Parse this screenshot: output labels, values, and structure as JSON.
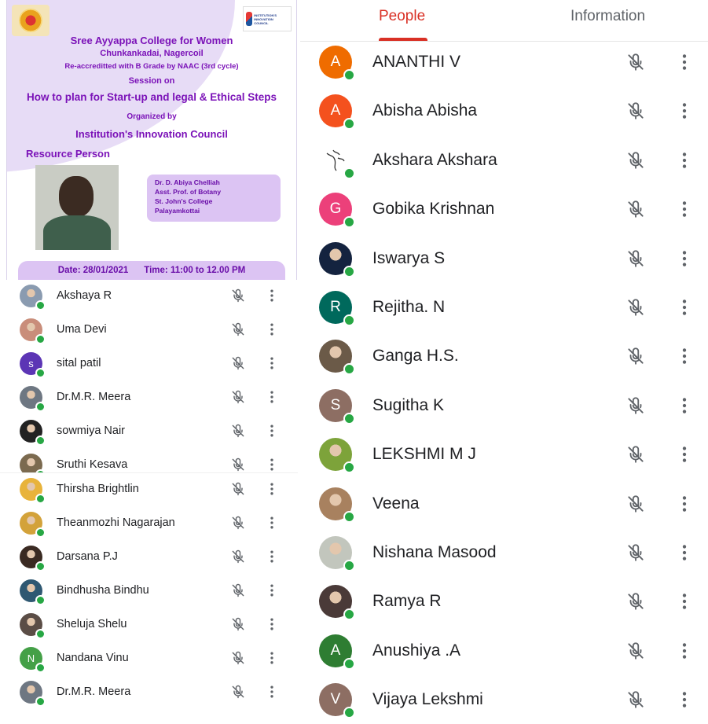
{
  "poster": {
    "college": "Sree Ayyappa College for Women",
    "place": "Chunkankadai, Nagercoil",
    "accreditation": "Re-accreditted with B Grade by NAAC (3rd cycle)",
    "session_label": "Session on",
    "topic": "How to plan for Start-up and legal & Ethical Steps",
    "organized_by": "Organized by",
    "council": "Institution's Innovation Council",
    "logo_right_text": "INSTITUTION'S INNOVATION COUNCIL",
    "resource_label": "Resource Person",
    "speaker": {
      "name": "Dr. D. Abiya Chelliah",
      "role": "Asst. Prof. of Botany",
      "college": "St. John's College",
      "city": "Palayamkottai"
    },
    "date": "Date: 28/01/2021",
    "time": "Time: 11:00 to 12.00 PM"
  },
  "left_list": [
    {
      "name": "Akshaya R",
      "avatar": "photo",
      "color": "#8a9bb0",
      "initial": ""
    },
    {
      "name": "Uma Devi",
      "avatar": "photo",
      "color": "#c98d7a",
      "initial": ""
    },
    {
      "name": "sital patil",
      "avatar": "letter",
      "color": "#5c35b5",
      "initial": "s"
    },
    {
      "name": "Dr.M.R. Meera",
      "avatar": "photo",
      "color": "#6e7782",
      "initial": ""
    },
    {
      "name": "sowmiya Nair",
      "avatar": "photo",
      "color": "#222222",
      "initial": ""
    },
    {
      "name": "Sruthi Kesava",
      "avatar": "photo",
      "color": "#7b6a4f",
      "initial": "",
      "cut": true
    },
    {
      "name": "Thirsha Brightlin",
      "avatar": "photo",
      "color": "#e8b33b",
      "initial": ""
    },
    {
      "name": "Theanmozhi Nagarajan",
      "avatar": "photo",
      "color": "#d3a23a",
      "initial": ""
    },
    {
      "name": "Darsana P.J",
      "avatar": "photo",
      "color": "#3a2a22",
      "initial": ""
    },
    {
      "name": "Bindhusha Bindhu",
      "avatar": "photo",
      "color": "#2f5872",
      "initial": ""
    },
    {
      "name": "Sheluja Shelu",
      "avatar": "photo",
      "color": "#5b4d46",
      "initial": ""
    },
    {
      "name": "Nandana Vinu",
      "avatar": "letter",
      "color": "#44a047",
      "initial": "N"
    },
    {
      "name": "Dr.M.R. Meera",
      "avatar": "photo",
      "color": "#6e7782",
      "initial": ""
    }
  ],
  "right_panel": {
    "tabs": {
      "people": "People",
      "information": "Information"
    },
    "participants": [
      {
        "name": "ANANTHI V",
        "avatar": "letter",
        "color": "#ef6c00",
        "initial": "A"
      },
      {
        "name": "Abisha Abisha",
        "avatar": "letter",
        "color": "#f4511e",
        "initial": "A"
      },
      {
        "name": "Akshara Akshara",
        "avatar": "sketch",
        "color": "#ffffff",
        "initial": ""
      },
      {
        "name": "Gobika Krishnan",
        "avatar": "letter",
        "color": "#ec407a",
        "initial": "G"
      },
      {
        "name": "Iswarya S",
        "avatar": "photo",
        "color": "#14233f",
        "initial": ""
      },
      {
        "name": "Rejitha. N",
        "avatar": "letter",
        "color": "#00695c",
        "initial": "R"
      },
      {
        "name": "Ganga H.S.",
        "avatar": "photo",
        "color": "#6b5a48",
        "initial": ""
      },
      {
        "name": "Sugitha K",
        "avatar": "letter",
        "color": "#8d6e63",
        "initial": "S"
      },
      {
        "name": "LEKSHMI M J",
        "avatar": "photo",
        "color": "#7da33a",
        "initial": ""
      },
      {
        "name": "Veena",
        "avatar": "photo",
        "color": "#a8815f",
        "initial": ""
      },
      {
        "name": "Nishana Masood",
        "avatar": "photo",
        "color": "#c2c6bd",
        "initial": ""
      },
      {
        "name": "Ramya R",
        "avatar": "photo",
        "color": "#4a3a38",
        "initial": ""
      },
      {
        "name": "Anushiya .A",
        "avatar": "letter",
        "color": "#2e7d32",
        "initial": "A"
      },
      {
        "name": "Vijaya Lekshmi",
        "avatar": "letter",
        "color": "#8d6e63",
        "initial": "V"
      }
    ]
  },
  "icons": {
    "mic_muted": "mic-off-icon",
    "more": "more-vert-icon"
  }
}
